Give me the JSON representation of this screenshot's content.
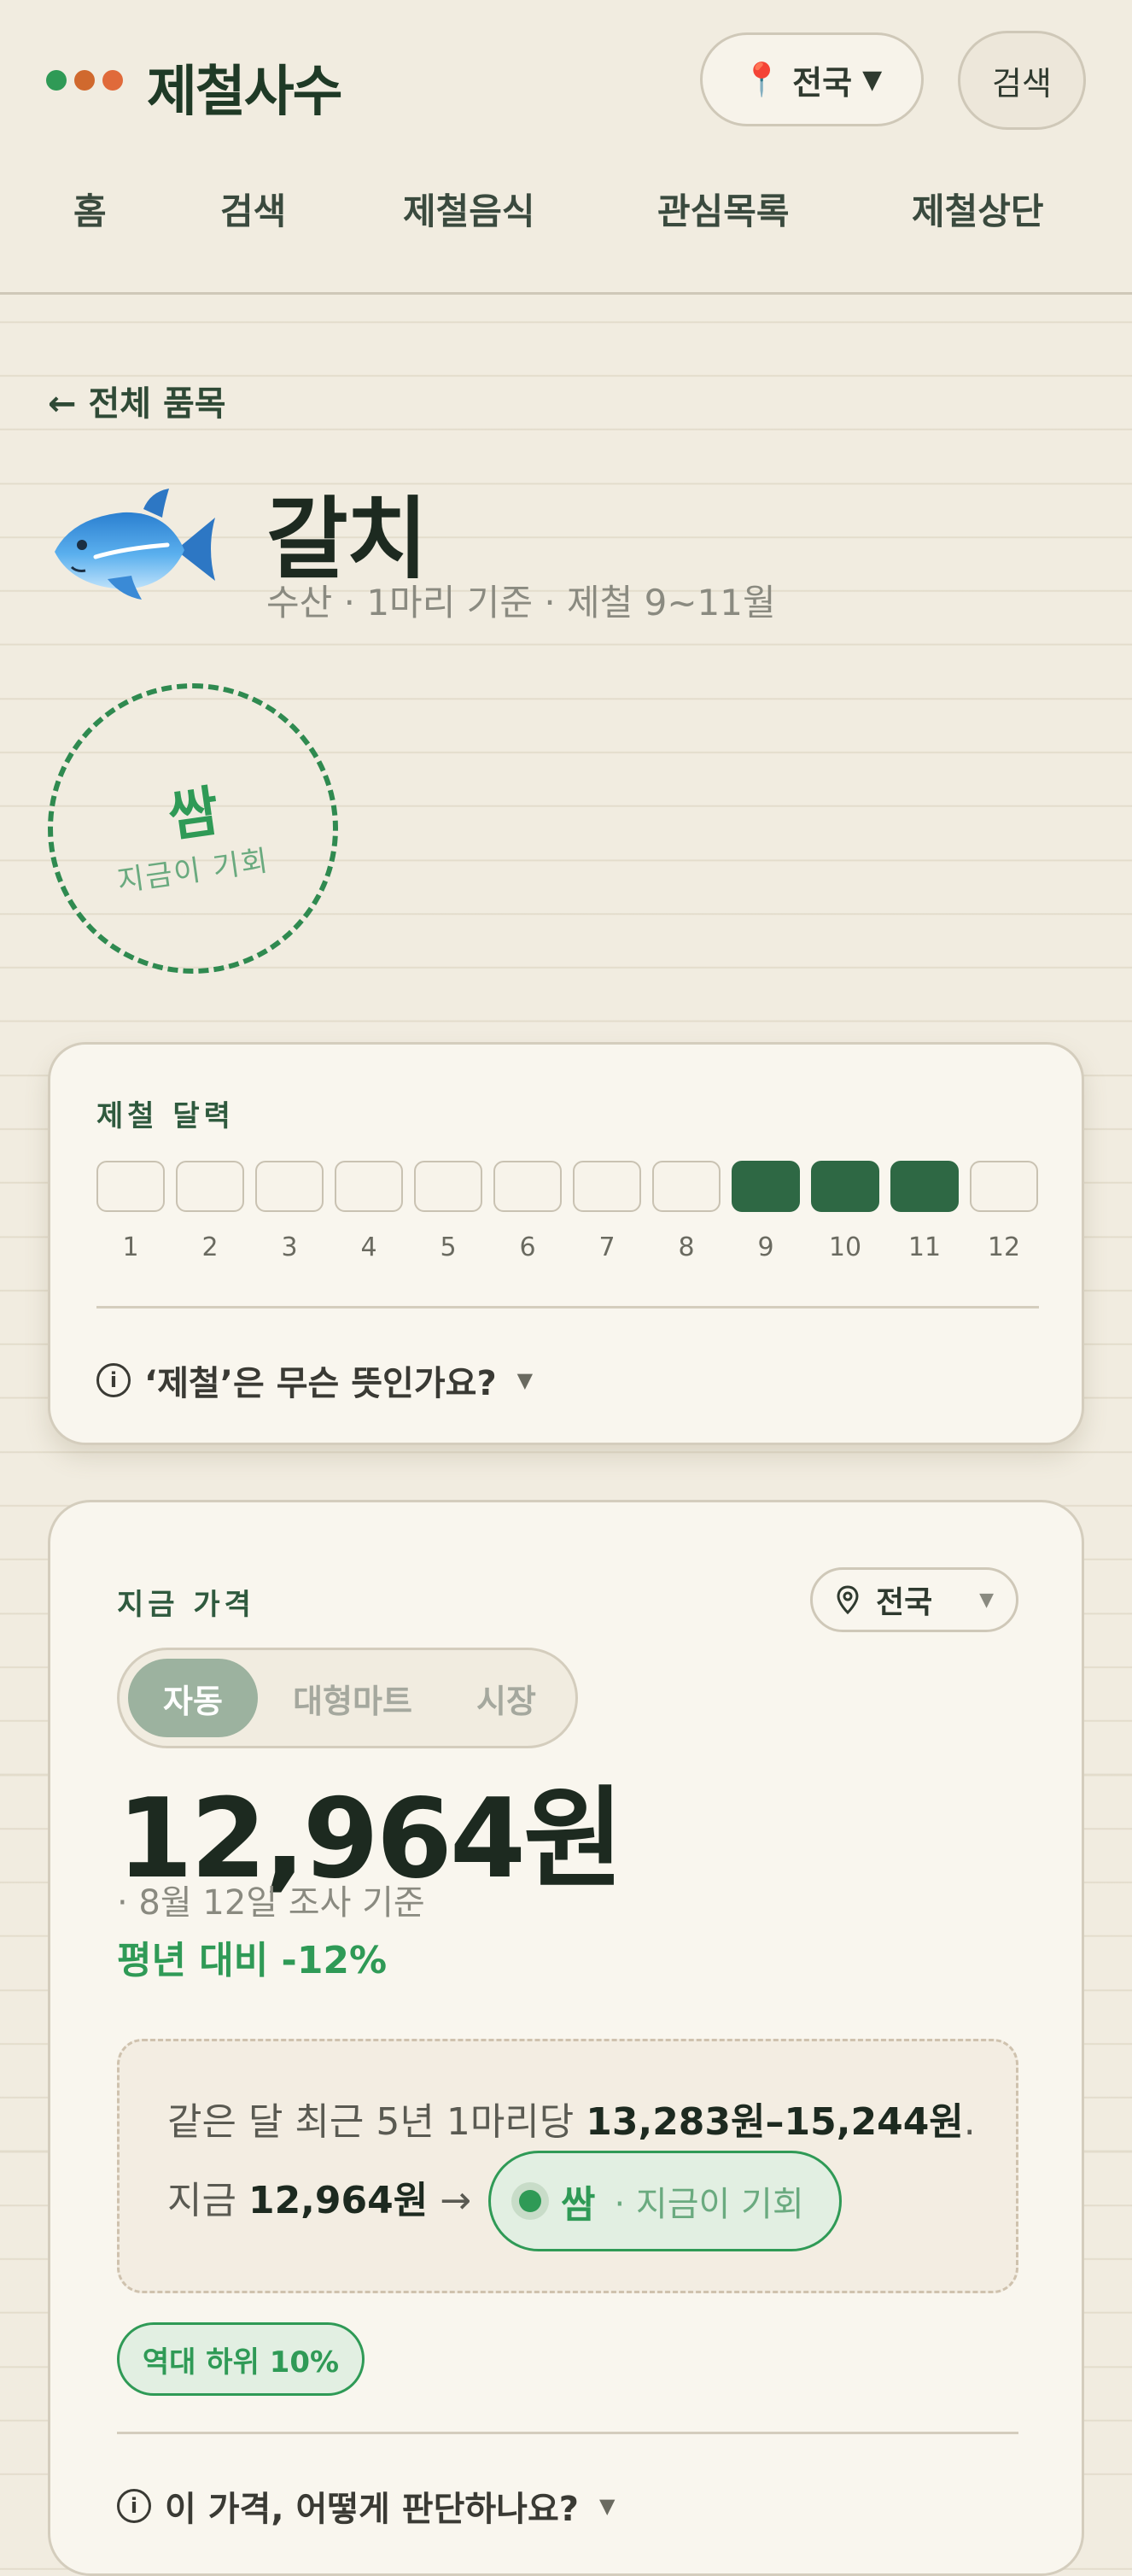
{
  "colors": {
    "dot1": "#2f9a56",
    "dot2": "#d0692e",
    "dot3": "#e06a3a",
    "accent_green": "#2f9a56",
    "calendar_on": "#2e6844"
  },
  "header": {
    "brand": "제철사수",
    "region_label": "전국",
    "region_icon": "pin-icon",
    "search_label": "검색"
  },
  "nav": {
    "items": [
      "홈",
      "검색",
      "제철음식",
      "관심목록",
      "제철상단"
    ]
  },
  "back_link": "← 전체 품목",
  "item": {
    "icon": "fish-icon",
    "name": "갈치",
    "subtitle": "수산 · 1마리 기준 · 제철 9~11월"
  },
  "stamp": {
    "main": "쌈",
    "sub": "지금이 기회"
  },
  "calendar": {
    "label": "제철 달력",
    "months": [
      "1",
      "2",
      "3",
      "4",
      "5",
      "6",
      "7",
      "8",
      "9",
      "10",
      "11",
      "12"
    ],
    "season_months": [
      9,
      10,
      11
    ],
    "faq": "‘제철’은 무슨 뜻인가요?"
  },
  "price_card": {
    "label": "지금 가격",
    "region": "전국",
    "tabs": [
      "자동",
      "대형마트",
      "시장"
    ],
    "active_tab": 0,
    "price": "12,964원",
    "as_of": "· 8월 12일 조사 기준",
    "vs_avg": "평년 대비 -12%",
    "range_prefix": "같은 달 최근 5년 1마리당 ",
    "range_value": "13,283원–15,244원",
    "range_suffix": ".",
    "now_prefix": "지금 ",
    "now_value": "12,964원",
    "now_arrow": " →",
    "verdict_main": "쌈",
    "verdict_sub": "· 지금이 기회",
    "badge": "역대 하위 10%",
    "faq": "이 가격, 어떻게 판단하나요?"
  }
}
